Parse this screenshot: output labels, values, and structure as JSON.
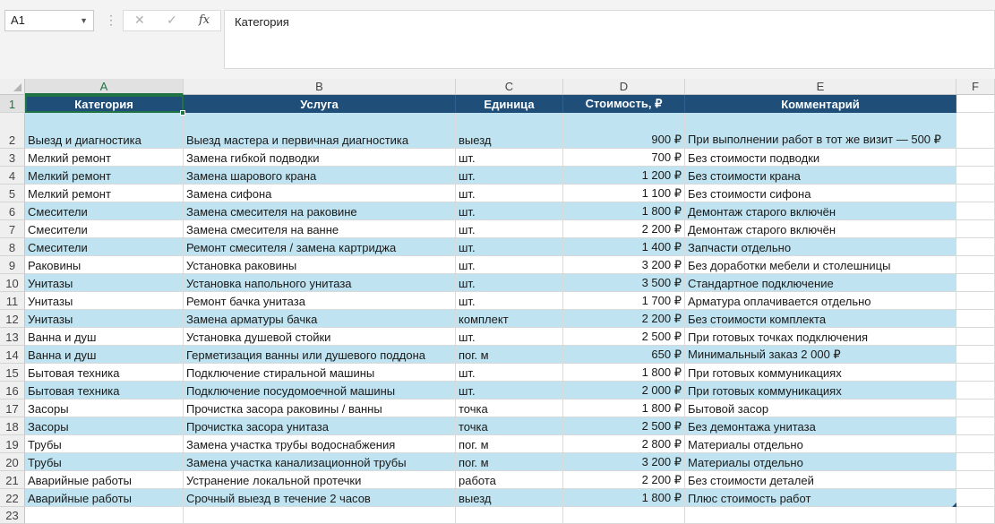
{
  "formula_bar": {
    "name_box": "A1",
    "cancel_icon": "✕",
    "confirm_icon": "✓",
    "fx_label": "fx",
    "content": "Категория"
  },
  "columns": [
    "A",
    "B",
    "C",
    "D",
    "E",
    "F"
  ],
  "header_row": {
    "row_number": "1",
    "cells": [
      "Категория",
      "Услуга",
      "Единица",
      "Стоимость, ₽",
      "Комментарий"
    ]
  },
  "rows": [
    {
      "n": "2",
      "cells": [
        "Выезд и диагностика",
        "Выезд мастера и первичная диагностика",
        "выезд",
        "900 ₽",
        "При выполнении работ в тот же визит — 500 ₽"
      ]
    },
    {
      "n": "3",
      "cells": [
        "Мелкий ремонт",
        "Замена гибкой подводки",
        "шт.",
        "700 ₽",
        "Без стоимости подводки"
      ]
    },
    {
      "n": "4",
      "cells": [
        "Мелкий ремонт",
        "Замена шарового крана",
        "шт.",
        "1 200 ₽",
        "Без стоимости крана"
      ]
    },
    {
      "n": "5",
      "cells": [
        "Мелкий ремонт",
        "Замена сифона",
        "шт.",
        "1 100 ₽",
        "Без стоимости сифона"
      ]
    },
    {
      "n": "6",
      "cells": [
        "Смесители",
        "Замена смесителя на раковине",
        "шт.",
        "1 800 ₽",
        "Демонтаж старого включён"
      ]
    },
    {
      "n": "7",
      "cells": [
        "Смесители",
        "Замена смесителя на ванне",
        "шт.",
        "2 200 ₽",
        "Демонтаж старого включён"
      ]
    },
    {
      "n": "8",
      "cells": [
        "Смесители",
        "Ремонт смесителя / замена картриджа",
        "шт.",
        "1 400 ₽",
        "Запчасти отдельно"
      ]
    },
    {
      "n": "9",
      "cells": [
        "Раковины",
        "Установка раковины",
        "шт.",
        "3 200 ₽",
        "Без доработки мебели и столешницы"
      ]
    },
    {
      "n": "10",
      "cells": [
        "Унитазы",
        "Установка напольного унитаза",
        "шт.",
        "3 500 ₽",
        "Стандартное подключение"
      ]
    },
    {
      "n": "11",
      "cells": [
        "Унитазы",
        "Ремонт бачка унитаза",
        "шт.",
        "1 700 ₽",
        "Арматура оплачивается отдельно"
      ]
    },
    {
      "n": "12",
      "cells": [
        "Унитазы",
        "Замена арматуры бачка",
        "комплект",
        "2 200 ₽",
        "Без стоимости комплекта"
      ]
    },
    {
      "n": "13",
      "cells": [
        "Ванна и душ",
        "Установка душевой стойки",
        "шт.",
        "2 500 ₽",
        "При готовых точках подключения"
      ]
    },
    {
      "n": "14",
      "cells": [
        "Ванна и душ",
        "Герметизация ванны или душевого поддона",
        "пог. м",
        "650 ₽",
        "Минимальный заказ 2 000 ₽"
      ]
    },
    {
      "n": "15",
      "cells": [
        "Бытовая техника",
        "Подключение стиральной машины",
        "шт.",
        "1 800 ₽",
        "При готовых коммуникациях"
      ]
    },
    {
      "n": "16",
      "cells": [
        "Бытовая техника",
        "Подключение посудомоечной машины",
        "шт.",
        "2 000 ₽",
        "При готовых коммуникациях"
      ]
    },
    {
      "n": "17",
      "cells": [
        "Засоры",
        "Прочистка засора раковины / ванны",
        "точка",
        "1 800 ₽",
        "Бытовой засор"
      ]
    },
    {
      "n": "18",
      "cells": [
        "Засоры",
        "Прочистка засора унитаза",
        "точка",
        "2 500 ₽",
        "Без демонтажа унитаза"
      ]
    },
    {
      "n": "19",
      "cells": [
        "Трубы",
        "Замена участка трубы водоснабжения",
        "пог. м",
        "2 800 ₽",
        "Материалы отдельно"
      ]
    },
    {
      "n": "20",
      "cells": [
        "Трубы",
        "Замена участка канализационной трубы",
        "пог. м",
        "3 200 ₽",
        "Материалы отдельно"
      ]
    },
    {
      "n": "21",
      "cells": [
        "Аварийные работы",
        "Устранение локальной протечки",
        "работа",
        "2 200 ₽",
        "Без стоимости деталей"
      ]
    },
    {
      "n": "22",
      "cells": [
        "Аварийные работы",
        "Срочный выезд в течение 2 часов",
        "выезд",
        "1 800 ₽",
        "Плюс стоимость работ"
      ]
    }
  ],
  "empty_row": "23",
  "colors": {
    "header_fill": "#1f4e79",
    "band_fill": "#bfe3f1",
    "white_fill": "#ffffff",
    "selection": "#217346"
  }
}
